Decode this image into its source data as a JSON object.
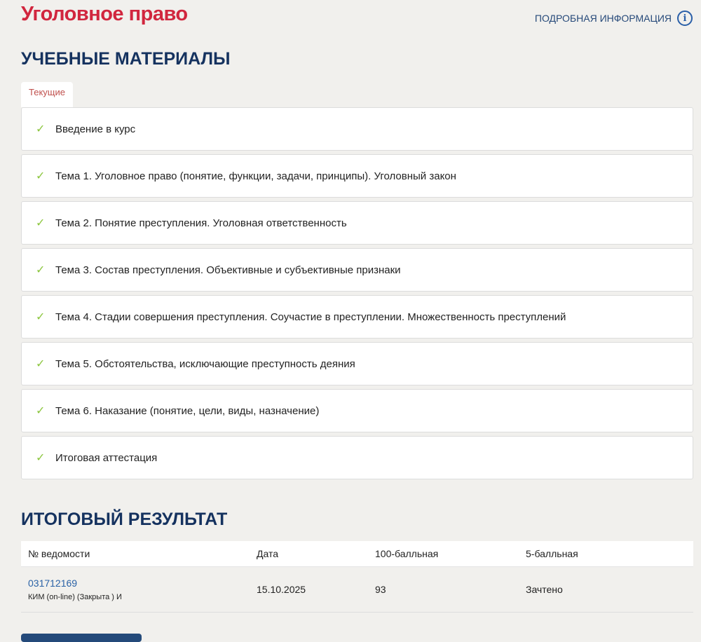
{
  "header": {
    "title": "Уголовное право",
    "info_link": "ПОДРОБНАЯ ИНФОРМАЦИЯ",
    "info_icon": "i"
  },
  "materials": {
    "heading": "УЧЕБНЫЕ МАТЕРИАЛЫ",
    "tab": "Текущие",
    "check": "✓",
    "items": [
      "Введение в курс",
      "Тема 1. Уголовное право (понятие, функции, задачи, принципы). Уголовный закон",
      "Тема 2. Понятие преступления. Уголовная ответственность",
      "Тема 3. Состав преступления. Объективные и субъективные признаки",
      "Тема 4. Стадии совершения преступления. Соучастие в преступлении. Множественность преступлений",
      "Тема 5. Обстоятельства, исключающие преступность деяния",
      "Тема 6. Наказание (понятие, цели, виды, назначение)",
      "Итоговая аттестация"
    ]
  },
  "result": {
    "heading": "ИТОГОВЫЙ РЕЗУЛЬТАТ",
    "columns": [
      "№ ведомости",
      "Дата",
      "100-балльная",
      "5-балльная"
    ],
    "rows": [
      {
        "number": "031712169",
        "note": "КИМ (on-line) (Закрыта ) И",
        "date": "15.10.2025",
        "score100": "93",
        "score5": "Зачтено"
      }
    ]
  }
}
